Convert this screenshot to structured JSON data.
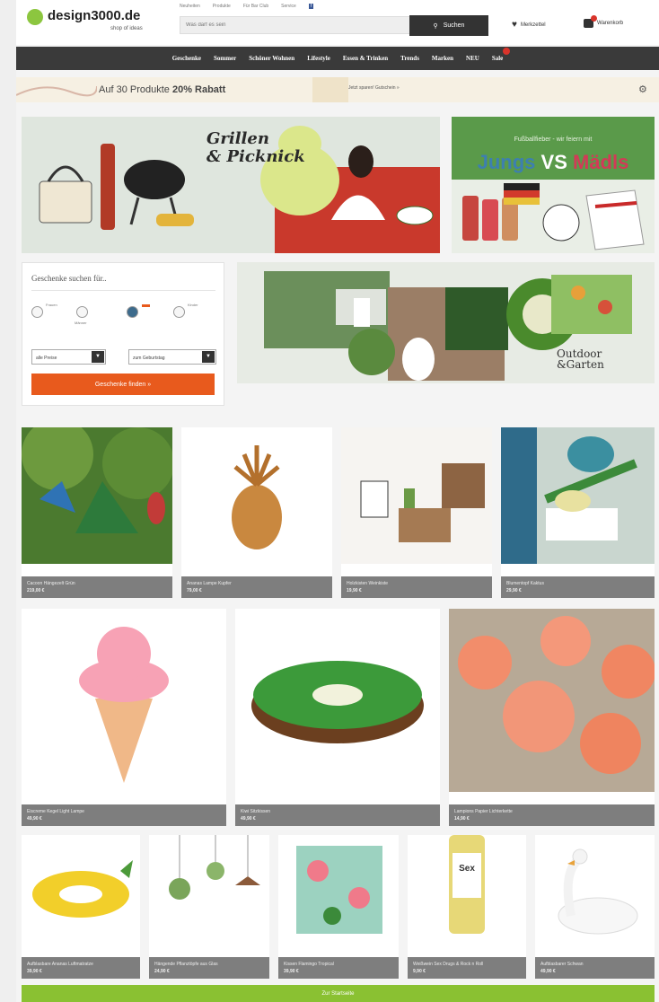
{
  "header": {
    "logo": "design3000.de",
    "logo_sub": "shop of ideas",
    "toplinks": [
      "Neuheiten",
      "Produkte",
      "Für Bar Club",
      "Service"
    ],
    "search_placeholder": "Was darf es sein",
    "search_button": "Suchen",
    "wishlist": "Merkzettel",
    "cart": "Warenkorb"
  },
  "nav": {
    "items": [
      "Geschenke",
      "Sommer",
      "Schöner Wohnen",
      "Lifestyle",
      "Essen & Trinken",
      "Trends",
      "Marken",
      "NEU",
      "Sale"
    ]
  },
  "promo": {
    "text_prefix": "Auf ",
    "text_middle": "30 Produkte ",
    "text_bold": "20% Rabatt",
    "link": "Jetzt sparen! Gutschein »"
  },
  "hero": {
    "left_title_line1": "Grillen",
    "left_title_line2": "& Picknick",
    "right_sub": "Fußballfieber - wir feiern mit",
    "right_jungs": "Jungs",
    "right_vs": " VS ",
    "right_madls": "Mädls"
  },
  "finder": {
    "title": "Geschenke suchen für..",
    "radio_labels": [
      "Frauen",
      "Männer",
      "",
      "Kinder"
    ],
    "select1": "alle Preise",
    "select2": "zum Geburtstag",
    "button": "Geschenke finden »"
  },
  "outdoor": {
    "title_line1": "Outdoor",
    "title_line2": "&Garten"
  },
  "products_row1": [
    {
      "name": "Cacoon Hängezelt Grün",
      "price": "219,00 €"
    },
    {
      "name": "Ananas Lampe Kupfer",
      "price": "79,00 €"
    },
    {
      "name": "Holzkisten Weinkiste",
      "price": "19,90 €"
    },
    {
      "name": "Blumentopf Kaktus",
      "price": "29,90 €"
    }
  ],
  "products_row2": [
    {
      "name": "Eiscreme Kegel Light Lampe",
      "price": "49,90 €"
    },
    {
      "name": "Kiwi Sitzkissen",
      "price": "49,90 €"
    },
    {
      "name": "Lampions Papier Lichterkette",
      "price": "14,90 €"
    }
  ],
  "products_row3": [
    {
      "name": "Aufblasbare Ananas Luftmatratze",
      "price": "39,90 €"
    },
    {
      "name": "Hängende Pflanztöpfe aus Glas",
      "price": "24,90 €"
    },
    {
      "name": "Kissen Flamingo Tropical",
      "price": "39,90 €"
    },
    {
      "name": "Weißwein Sex Drugs & Rock n Roll",
      "price": "9,90 €"
    },
    {
      "name": "Aufblasbarer Schwan",
      "price": "49,90 €"
    }
  ],
  "footer_button": "Zur Startseite"
}
